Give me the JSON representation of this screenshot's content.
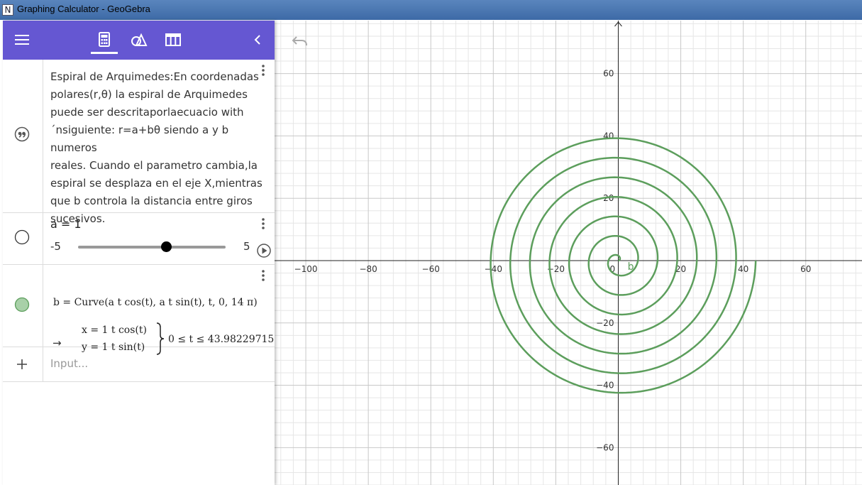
{
  "window": {
    "title": "Graphing Calculator - GeoGebra"
  },
  "toolbar": {
    "tabs": [
      {
        "name": "calculator",
        "active": true
      },
      {
        "name": "geometry",
        "active": false
      },
      {
        "name": "table",
        "active": false
      }
    ],
    "menu_icon": "hamburger-icon",
    "collapse_icon": "chevron-left-icon"
  },
  "algebra": {
    "text_item": {
      "lines": [
        "Espiral de Arquimedes:En coordenadas",
        "polares(r,θ) la espiral de Arquimedes",
        "puede ser descritaporlaecuacio with",
        "´nsiguiente: r=a+bθ siendo a y b numeros",
        "reales. Cuando el parametro cambia,la",
        "espiral se desplaza en el eje X,mientras",
        "que b controla la distancia entre giros",
        "sucesivos."
      ]
    },
    "slider": {
      "label": "a = 1",
      "min_label": "-5",
      "max_label": "5",
      "min": -5,
      "max": 5,
      "value": 1
    },
    "curve": {
      "definition": "b = Curve(a t cos(t), a t sin(t), t, 0, 14 π)",
      "arrow": "→",
      "x_eq": "x = 1 t cos(t)",
      "y_eq": "y = 1 t sin(t)",
      "range": "0 ≤ t ≤ 43.98229715",
      "color": "#5c9e5c"
    },
    "input": {
      "placeholder": "Input..."
    }
  },
  "graph": {
    "x_ticks": [
      "−100",
      "−80",
      "−60",
      "−40",
      "−20",
      "0",
      "20",
      "40",
      "60"
    ],
    "y_ticks": [
      "60",
      "40",
      "20",
      "−20",
      "−40",
      "−60"
    ],
    "curve_label": "b",
    "curve_color": "#5c9e5c"
  },
  "chart_data": {
    "type": "line",
    "title": "",
    "xlabel": "",
    "ylabel": "",
    "xlim": [
      -110,
      78
    ],
    "ylim": [
      -72,
      77
    ],
    "grid": true,
    "series": [
      {
        "name": "b",
        "equation": "x = t cos(t), y = t sin(t)",
        "t_range": [
          0,
          43.98229715
        ]
      }
    ]
  }
}
